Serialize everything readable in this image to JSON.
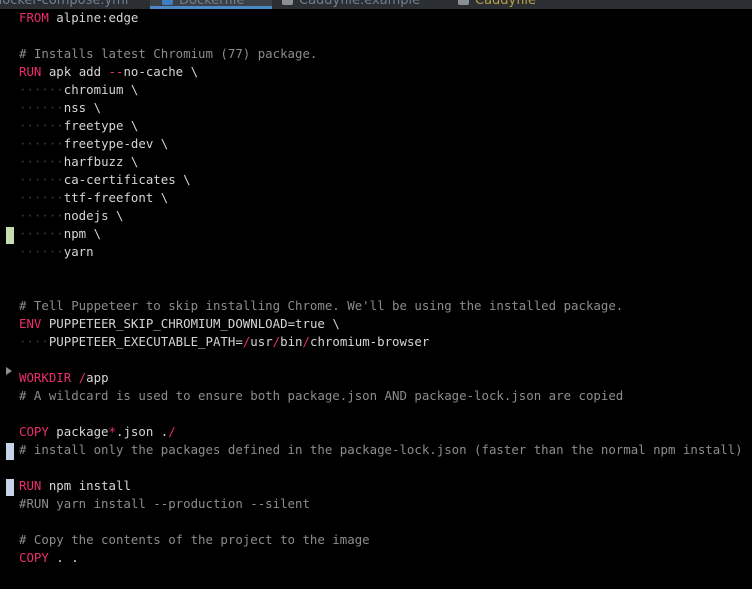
{
  "tabs": [
    {
      "label": "docker-compose.yml",
      "active": false,
      "color": "#6f7f93"
    },
    {
      "label": "Dockerfile",
      "active": true,
      "color": "#6f7f93"
    },
    {
      "label": "Caddyfile.example",
      "active": false,
      "color": "#6f7f93"
    },
    {
      "label": "Caddyfile",
      "active": false,
      "color": "#b5a042"
    }
  ],
  "colors": {
    "background": "#000000",
    "keyword": "#ec2d6e",
    "comment": "#8c8c8c",
    "text": "#d5d5d5",
    "change_added": "#c6ddb1",
    "change_modified": "#c7d3e6",
    "active_tab_underline": "#4a88c7"
  },
  "code": {
    "from_kw": "FROM",
    "from_image": " alpine:edge",
    "comment_chromium": "# Installs latest Chromium (77) package.",
    "run1_kw": "RUN",
    "run1_cmd": " apk add ",
    "run1_flag": "--",
    "run1_rest": "no-cache \\",
    "pkg_chromium": "chromium \\",
    "pkg_nss": "nss \\",
    "pkg_freetype": "freetype \\",
    "pkg_freetype_dev": "freetype-dev \\",
    "pkg_harfbuzz": "harfbuzz \\",
    "pkg_ca": "ca-certificates \\",
    "pkg_ttf": "ttf-freefont \\",
    "pkg_nodejs": "nodejs \\",
    "pkg_npm": "npm \\",
    "pkg_yarn": "yarn",
    "comment_puppeteer": "# Tell Puppeteer to skip installing Chrome. We'll be using the installed package.",
    "env_kw": "ENV",
    "env1": " PUPPETEER_SKIP_CHROMIUM_DOWNLOAD=true \\",
    "env2_a": "PUPPETEER_EXECUTABLE_PATH=",
    "env2_s1": "/",
    "env2_b": "usr",
    "env2_s2": "/",
    "env2_c": "bin",
    "env2_s3": "/",
    "env2_d": "chromium-browser",
    "workdir_kw": "WORKDIR",
    "workdir_sp": " ",
    "workdir_slash": "/",
    "workdir_path": "app",
    "comment_wildcard": "# A wildcard is used to ensure both package.json AND package-lock.json are copied",
    "copy1_kw": "COPY",
    "copy1_a": " package",
    "copy1_star": "*",
    "copy1_b": ".json ",
    "copy1_c": ".",
    "copy1_slash": "/",
    "comment_install": "# install only the packages defined in the package-lock.json (faster than the normal npm install)",
    "run2_kw": "RUN",
    "run2_cmd": " npm install",
    "run_yarn_comment": "#RUN yarn install --production --silent",
    "comment_copy": "# Copy the contents of the project to the image",
    "copy2_kw": "COPY",
    "copy2_args": " . ."
  }
}
